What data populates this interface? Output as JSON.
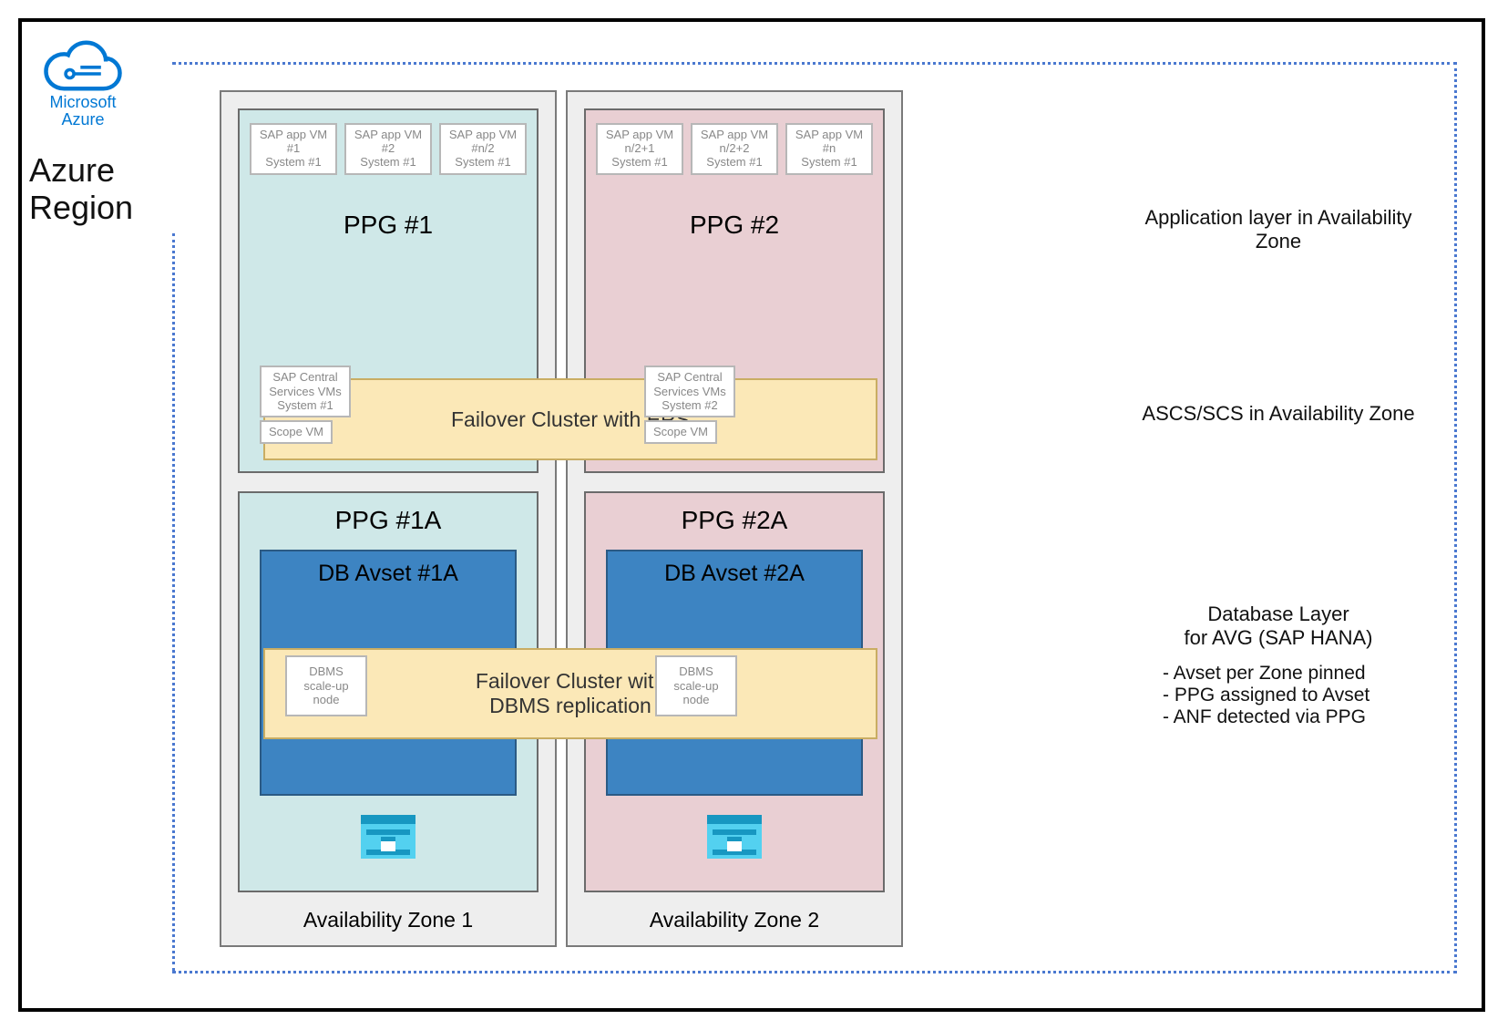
{
  "brand": {
    "line1": "Microsoft",
    "line2": "Azure"
  },
  "region_label": "Azure\nRegion",
  "zones": {
    "az1": {
      "label": "Availability Zone 1",
      "ppg_top": {
        "title": "PPG #1",
        "vms": [
          {
            "l1": "SAP app VM",
            "l2": "#1",
            "l3": "System #1"
          },
          {
            "l1": "SAP app VM",
            "l2": "#2",
            "l3": "System #1"
          },
          {
            "l1": "SAP app VM",
            "l2": "#n/2",
            "l3": "System #1"
          }
        ]
      },
      "ppg_bot": {
        "title": "PPG #1A",
        "db_avset": "DB Avset #1A"
      }
    },
    "az2": {
      "label": "Availability Zone 2",
      "ppg_top": {
        "title": "PPG #2",
        "vms": [
          {
            "l1": "SAP app VM",
            "l2": "n/2+1",
            "l3": "System #1"
          },
          {
            "l1": "SAP app VM",
            "l2": "n/2+2",
            "l3": "System #1"
          },
          {
            "l1": "SAP app VM",
            "l2": "#n",
            "l3": "System #1"
          }
        ]
      },
      "ppg_bot": {
        "title": "PPG #2A",
        "db_avset": "DB Avset #2A"
      }
    }
  },
  "failover": {
    "ers_title": "Failover Cluster with ERS",
    "db_title": "Failover Cluster with DBMS replication",
    "ers_box1": {
      "l1": "SAP Central",
      "l2": "Services VMs",
      "l3": "System #1"
    },
    "ers_box2": {
      "l1": "SAP Central",
      "l2": "Services VMs",
      "l3": "System #2"
    },
    "scope": "Scope VM",
    "dbms_box": {
      "l1": "DBMS",
      "l2": "scale-up",
      "l3": "node"
    }
  },
  "notes": {
    "app": "Application layer in Availability Zone",
    "ascs": "ASCS/SCS in Availability Zone",
    "db_title": "Database Layer",
    "db_sub": "for AVG (SAP HANA)",
    "bullets": [
      "Avset per Zone pinned",
      "PPG assigned to Avset",
      "ANF detected via PPG"
    ]
  }
}
